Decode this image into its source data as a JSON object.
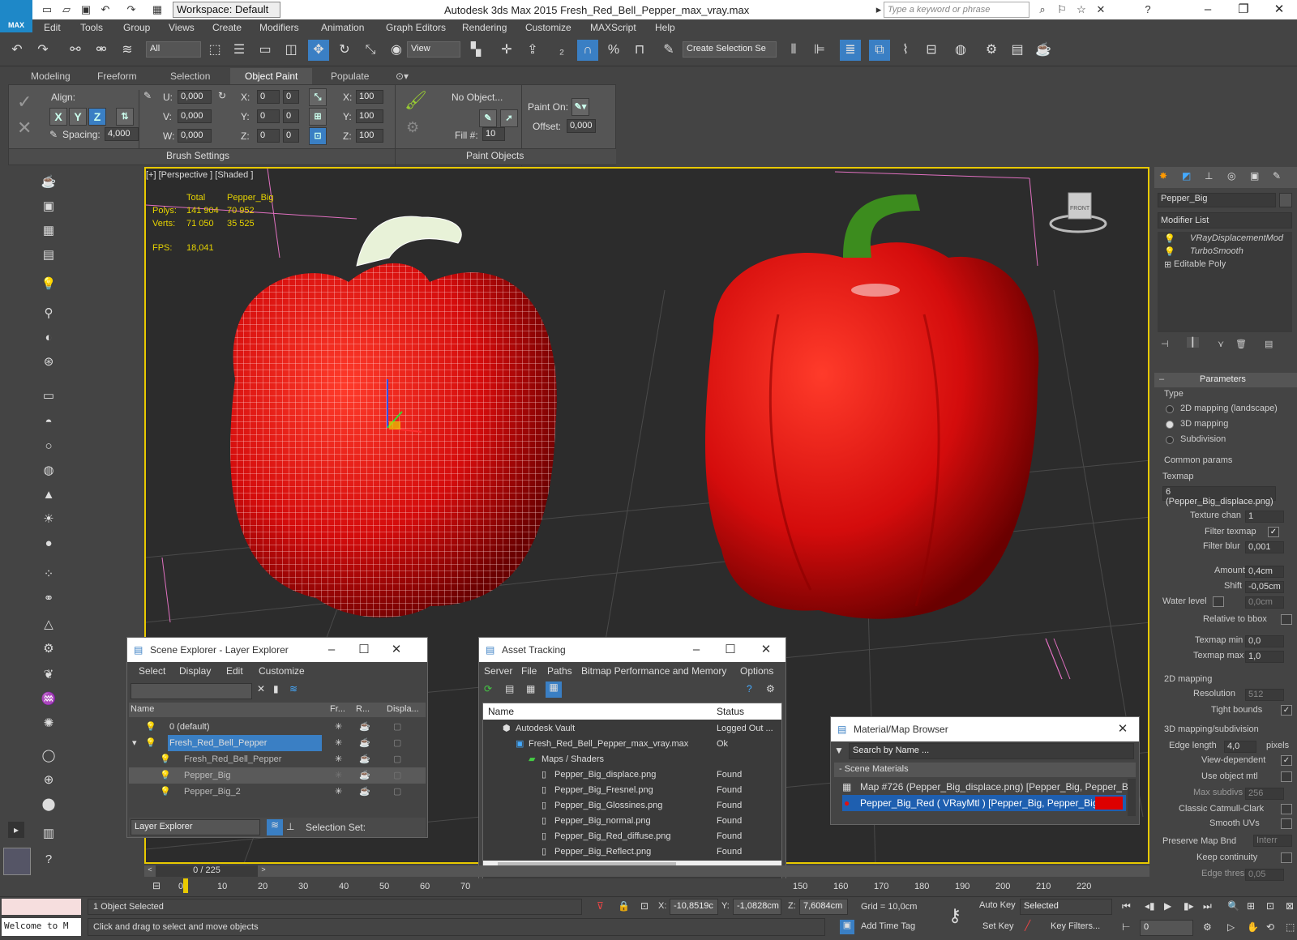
{
  "title": "Autodesk 3ds Max  2015    Fresh_Red_Bell_Pepper_max_vray.max",
  "logo_text": "MAX",
  "workspace": "Workspace: Default",
  "search_placeholder": "Type a keyword or phrase",
  "menu": [
    "Edit",
    "Tools",
    "Group",
    "Views",
    "Create",
    "Modifiers",
    "Animation",
    "Graph Editors",
    "Rendering",
    "Customize",
    "MAXScript",
    "Help"
  ],
  "toolbar": {
    "filter": "All",
    "refcoord": "View",
    "selset": "Create Selection Se"
  },
  "ribbon_tabs": [
    "Modeling",
    "Freeform",
    "Selection",
    "Object Paint",
    "Populate"
  ],
  "ribbon": {
    "align_label": "Align:",
    "x": "X",
    "y": "Y",
    "z": "Z",
    "spacing_label": "Spacing:",
    "spacing": "4,000",
    "u_label": "U:",
    "u": "0,000",
    "v_label": "V:",
    "v": "0,000",
    "w_label": "W:",
    "w": "0,000",
    "rx": "0",
    "ry": "0",
    "rz": "0",
    "rx2": "0",
    "ry2": "0",
    "rz2": "0",
    "sx": "100",
    "sy": "100",
    "sz": "100",
    "sx_label": "X:",
    "sy_label": "Y:",
    "sz_label": "Z:",
    "no_object": "No Object...",
    "fill_label": "Fill #:",
    "fill": "10",
    "paint_on": "Paint On:",
    "offset_label": "Offset:",
    "offset": "0,000",
    "brush_settings": "Brush Settings",
    "paint_objects": "Paint Objects"
  },
  "viewport": {
    "label": "[+] [Perspective ] [Shaded ]",
    "stats_h1": "Total",
    "stats_h2": "Pepper_Big",
    "polys_label": "Polys:",
    "polys_total": "141 904",
    "polys_sel": "70 952",
    "verts_label": "Verts:",
    "verts_total": "71 050",
    "verts_sel": "35 525",
    "fps_label": "FPS:",
    "fps": "18,041",
    "viewcube": "FRONT"
  },
  "panel": {
    "object_name": "Pepper_Big",
    "modifier_list": "Modifier List",
    "stack": [
      "VRayDisplacementMod",
      "TurboSmooth",
      "Editable Poly"
    ],
    "parameters": "Parameters",
    "type_label": "Type",
    "type_opts": [
      "2D mapping (landscape)",
      "3D mapping",
      "Subdivision"
    ],
    "common": "Common params",
    "texmap_label": "Texmap",
    "texmap": "6 (Pepper_Big_displace.png)",
    "texture_chan_label": "Texture chan",
    "texture_chan": "1",
    "filter_texmap": "Filter texmap",
    "filter_blur_label": "Filter blur",
    "filter_blur": "0,001",
    "amount_label": "Amount",
    "amount": "0,4cm",
    "shift_label": "Shift",
    "shift": "-0,05cm",
    "water_label": "Water level",
    "water": "0,0cm",
    "relative": "Relative to bbox",
    "texmin_label": "Texmap min",
    "texmin": "0,0",
    "texmax_label": "Texmap max",
    "texmax": "1,0",
    "map2d": "2D mapping",
    "resolution_label": "Resolution",
    "resolution": "512",
    "tight": "Tight bounds",
    "map3d": "3D mapping/subdivision",
    "edge_label": "Edge length",
    "edge": "4,0",
    "pixels": "pixels",
    "viewdep": "View-dependent",
    "useobj": "Use object mtl",
    "maxsub_label": "Max subdivs",
    "maxsub": "256",
    "catmull": "Classic Catmull-Clark",
    "smoothuv": "Smooth UVs",
    "preserve_label": "Preserve Map Bnd",
    "preserve": "Interr",
    "keepcont": "Keep continuity",
    "edgethresh": "Edge thresh",
    "edgethresh_val": "0,05"
  },
  "scene_explorer": {
    "title": "Scene Explorer - Layer Explorer",
    "menu": [
      "Select",
      "Display",
      "Edit",
      "Customize"
    ],
    "cols": [
      "Name",
      "Fr...",
      "R...",
      "Displa..."
    ],
    "rows": [
      "0 (default)",
      "Fresh_Red_Bell_Pepper",
      "Fresh_Red_Bell_Pepper",
      "Pepper_Big",
      "Pepper_Big_2"
    ],
    "footer": "Layer Explorer",
    "selset": "Selection Set:"
  },
  "asset_tracking": {
    "title": "Asset Tracking",
    "menu": [
      "Server",
      "File",
      "Paths",
      "Bitmap Performance and Memory",
      "Options"
    ],
    "col_name": "Name",
    "col_status": "Status",
    "rows": [
      {
        "name": "Autodesk Vault",
        "status": "Logged Out ..."
      },
      {
        "name": "Fresh_Red_Bell_Pepper_max_vray.max",
        "status": "Ok"
      },
      {
        "name": "Maps / Shaders",
        "status": ""
      },
      {
        "name": "Pepper_Big_displace.png",
        "status": "Found"
      },
      {
        "name": "Pepper_Big_Fresnel.png",
        "status": "Found"
      },
      {
        "name": "Pepper_Big_Glossines.png",
        "status": "Found"
      },
      {
        "name": "Pepper_Big_normal.png",
        "status": "Found"
      },
      {
        "name": "Pepper_Big_Red_diffuse.png",
        "status": "Found"
      },
      {
        "name": "Pepper_Big_Reflect.png",
        "status": "Found"
      }
    ]
  },
  "material_browser": {
    "title": "Material/Map Browser",
    "search": "Search by Name ...",
    "group": "- Scene Materials",
    "items": [
      "Map #726 (Pepper_Big_displace.png) [Pepper_Big, Pepper_B...",
      "Pepper_Big_Red ( VRayMtl ) [Pepper_Big, Pepper_Big_2]"
    ]
  },
  "timeline": {
    "frame": "0 / 225",
    "ticks": [
      "0",
      "10",
      "20",
      "30",
      "40",
      "50",
      "60",
      "70",
      "150",
      "160",
      "170",
      "180",
      "190",
      "200",
      "210",
      "220"
    ]
  },
  "status": {
    "welcome": "Welcome to M",
    "selected": "1 Object Selected",
    "prompt": "Click and drag to select and move objects",
    "x_label": "X:",
    "x": "-10,8519c",
    "y_label": "Y:",
    "y": "-1,0828cm",
    "z_label": "Z:",
    "z": "7,6084cm",
    "grid": "Grid = 10,0cm",
    "add_time_tag": "Add Time Tag",
    "autokey": "Auto Key",
    "setkey": "Set Key",
    "selected_drop": "Selected",
    "key_filters": "Key Filters...",
    "frame_field": "0"
  },
  "colors": {
    "accent": "#3a7fc4",
    "viewport_border": "#e8c900",
    "pepper_red": "#e01010",
    "stem_green": "#3c8c1e"
  }
}
